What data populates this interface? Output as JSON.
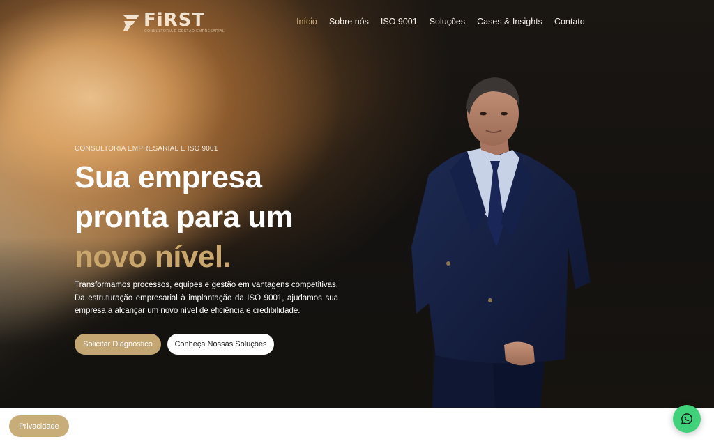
{
  "brand": {
    "name": "FiRST",
    "tagline": "CONSULTORIA E GESTÃO EMPRESARIAL"
  },
  "nav": {
    "items": [
      {
        "label": "Início",
        "active": true
      },
      {
        "label": "Sobre nós",
        "active": false
      },
      {
        "label": "ISO 9001",
        "active": false
      },
      {
        "label": "Soluções",
        "active": false
      },
      {
        "label": "Cases & Insights",
        "active": false
      },
      {
        "label": "Contato",
        "active": false
      }
    ]
  },
  "hero": {
    "eyebrow": "CONSULTORIA EMPRESARIAL E ISO 9001",
    "headline_line1": "Sua empresa",
    "headline_line2": "pronta para um",
    "headline_highlight": "novo nível.",
    "description": "Transformamos processos, equipes e gestão em vantagens competitivas. Da estruturação empresarial à implantação da ISO 9001, ajudamos sua empresa a alcançar um novo nível de eficiência e credibilidade.",
    "primary_cta": "Solicitar Diagnóstico",
    "secondary_cta": "Conheça Nossas Soluções"
  },
  "footer": {
    "privacy_label": "Privacidade"
  },
  "colors": {
    "accent_gold": "#c9a66b",
    "button_gold": "#c4a673",
    "whatsapp_green": "#3fd27a",
    "nav_active": "#c9a877"
  },
  "icons": {
    "logo": "first-logo-icon",
    "whatsapp": "whatsapp-icon"
  }
}
